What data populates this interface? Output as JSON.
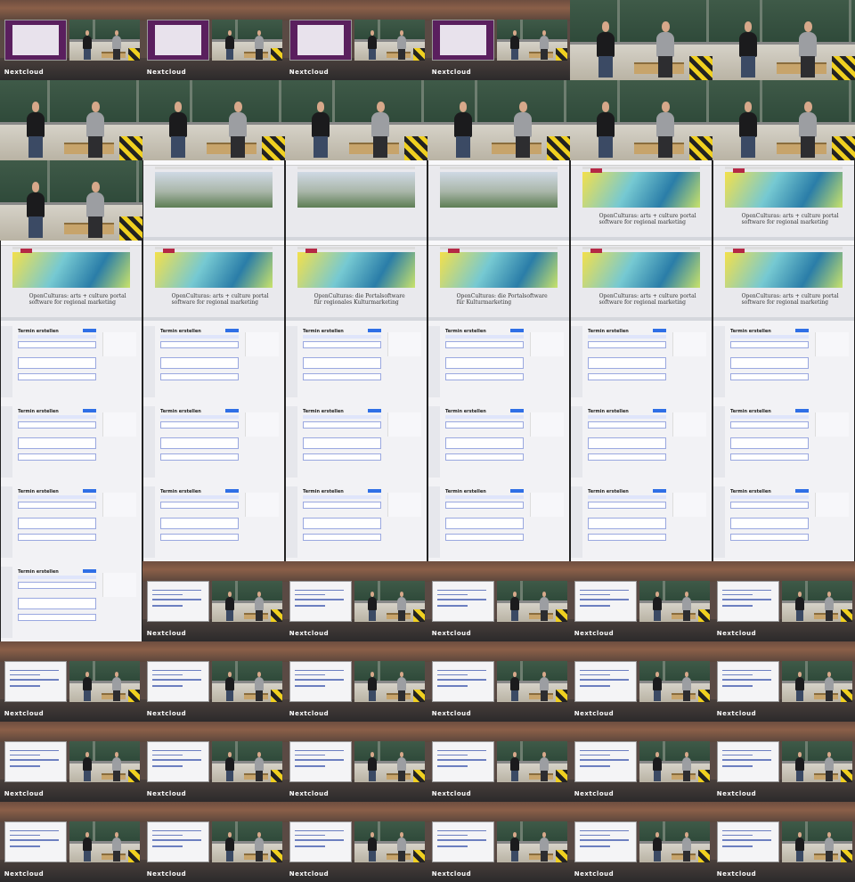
{
  "thumbnail_sheet": {
    "columns": 6,
    "rows": 11,
    "event_logo_text": "Nextcloud",
    "tiles": [
      "comp-purple",
      "comp-purple",
      "comp-purple",
      "comp-purple",
      "stage",
      "stage",
      "stage",
      "stage",
      "stage",
      "stage",
      "stage",
      "stage",
      "stage",
      "browser-garden",
      "browser-garden",
      "browser-garden",
      "browser-art",
      "browser-art",
      "browser-art",
      "browser-art",
      "browser-art",
      "browser-art",
      "browser-art",
      "browser-art",
      "admin",
      "admin",
      "admin",
      "admin",
      "admin",
      "admin",
      "admin",
      "admin",
      "admin",
      "admin",
      "admin",
      "admin",
      "admin",
      "admin",
      "admin",
      "admin",
      "admin",
      "admin",
      "admin",
      "comp-form",
      "comp-form",
      "comp-form",
      "comp-form",
      "comp-form",
      "comp-form",
      "comp-form",
      "comp-form",
      "comp-form",
      "comp-form",
      "comp-form",
      "comp-form",
      "comp-form",
      "comp-form",
      "comp-form",
      "comp-form",
      "comp-form",
      "comp-form",
      "comp-form",
      "comp-form",
      "comp-form",
      "comp-form",
      "comp-form"
    ],
    "webpage_text": [
      "OpenCulturas: arts + culture portal software for regional marketing",
      "OpenCulturas: arts + culture portal software for regional marketing",
      "OpenCulturas: arts + culture portal software for regional marketing",
      "OpenCulturas: arts + culture portal software for regional marketing",
      "OpenCulturas: die Portalsoftware für regionales Kulturmarketing",
      "OpenCulturas: die Portalsoftware für Kulturmarketing"
    ],
    "admin_heading": "Termin erstellen"
  }
}
